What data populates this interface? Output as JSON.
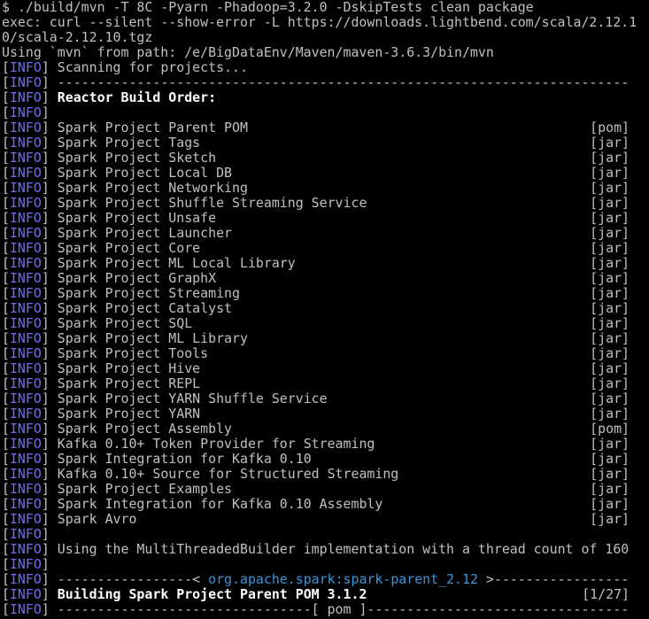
{
  "prompt": "$ ",
  "command": "./build/mvn -T 8C -Pyarn -Phadoop=3.2.0 -DskipTests clean package",
  "exec_line_1": "exec: curl --silent --show-error -L https://downloads.lightbend.com/scala/2.12.1",
  "exec_line_2": "0/scala-2.12.10.tgz",
  "using_line": "Using `mvn` from path: /e/BigDataEnv/Maven/maven-3.6.3/bin/mvn",
  "info_tag": "INFO",
  "scanning": "Scanning for projects...",
  "separator": "------------------------------------------------------------------------",
  "reactor_title": "Reactor Build Order:",
  "projects": [
    {
      "name": "Spark Project Parent POM",
      "type": "[pom]"
    },
    {
      "name": "Spark Project Tags",
      "type": "[jar]"
    },
    {
      "name": "Spark Project Sketch",
      "type": "[jar]"
    },
    {
      "name": "Spark Project Local DB",
      "type": "[jar]"
    },
    {
      "name": "Spark Project Networking",
      "type": "[jar]"
    },
    {
      "name": "Spark Project Shuffle Streaming Service",
      "type": "[jar]"
    },
    {
      "name": "Spark Project Unsafe",
      "type": "[jar]"
    },
    {
      "name": "Spark Project Launcher",
      "type": "[jar]"
    },
    {
      "name": "Spark Project Core",
      "type": "[jar]"
    },
    {
      "name": "Spark Project ML Local Library",
      "type": "[jar]"
    },
    {
      "name": "Spark Project GraphX",
      "type": "[jar]"
    },
    {
      "name": "Spark Project Streaming",
      "type": "[jar]"
    },
    {
      "name": "Spark Project Catalyst",
      "type": "[jar]"
    },
    {
      "name": "Spark Project SQL",
      "type": "[jar]"
    },
    {
      "name": "Spark Project ML Library",
      "type": "[jar]"
    },
    {
      "name": "Spark Project Tools",
      "type": "[jar]"
    },
    {
      "name": "Spark Project Hive",
      "type": "[jar]"
    },
    {
      "name": "Spark Project REPL",
      "type": "[jar]"
    },
    {
      "name": "Spark Project YARN Shuffle Service",
      "type": "[jar]"
    },
    {
      "name": "Spark Project YARN",
      "type": "[jar]"
    },
    {
      "name": "Spark Project Assembly",
      "type": "[pom]"
    },
    {
      "name": "Kafka 0.10+ Token Provider for Streaming",
      "type": "[jar]"
    },
    {
      "name": "Spark Integration for Kafka 0.10",
      "type": "[jar]"
    },
    {
      "name": "Kafka 0.10+ Source for Structured Streaming",
      "type": "[jar]"
    },
    {
      "name": "Spark Project Examples",
      "type": "[jar]"
    },
    {
      "name": "Spark Integration for Kafka 0.10 Assembly",
      "type": "[jar]"
    },
    {
      "name": "Spark Avro",
      "type": "[jar]"
    }
  ],
  "threaded_builder": "Using the MultiThreadedBuilder implementation with a thread count of 160",
  "artifact_left": "-----------------< ",
  "artifact_id": "org.apache.spark:spark-parent_2.12",
  "artifact_right": " >-----------------",
  "building": "Building Spark Project Parent POM 3.1.2",
  "building_progress": "[1/27]",
  "pom_line": "--------------------------------[ pom ]---------------------------------",
  "colors": {
    "background": "#000000",
    "text": "#c0c0c0",
    "info_tag": "#6d6df5",
    "bold_text": "#ffffff",
    "artifact": "#3a96dd"
  }
}
